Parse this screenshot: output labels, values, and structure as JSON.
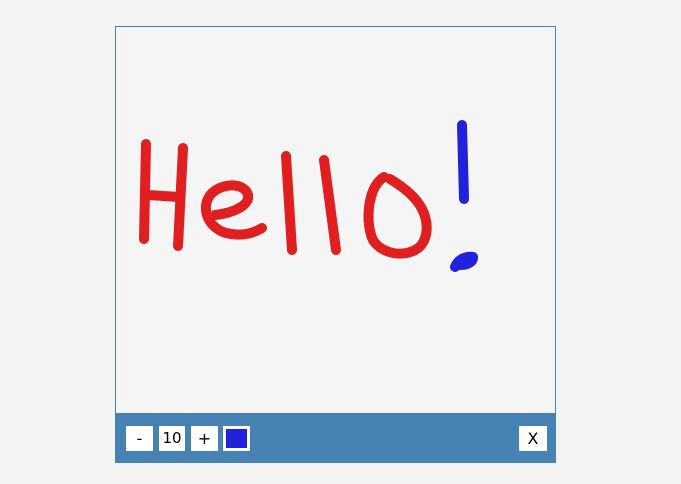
{
  "toolbar": {
    "decrease_label": "-",
    "brush_size": "10",
    "increase_label": "+",
    "close_label": "X"
  },
  "colors": {
    "frame": "#4682b4",
    "canvas": "#f5f5f5",
    "selected_color": "#2222dd",
    "red_ink": "#e02020",
    "blue_ink": "#2222dd"
  }
}
